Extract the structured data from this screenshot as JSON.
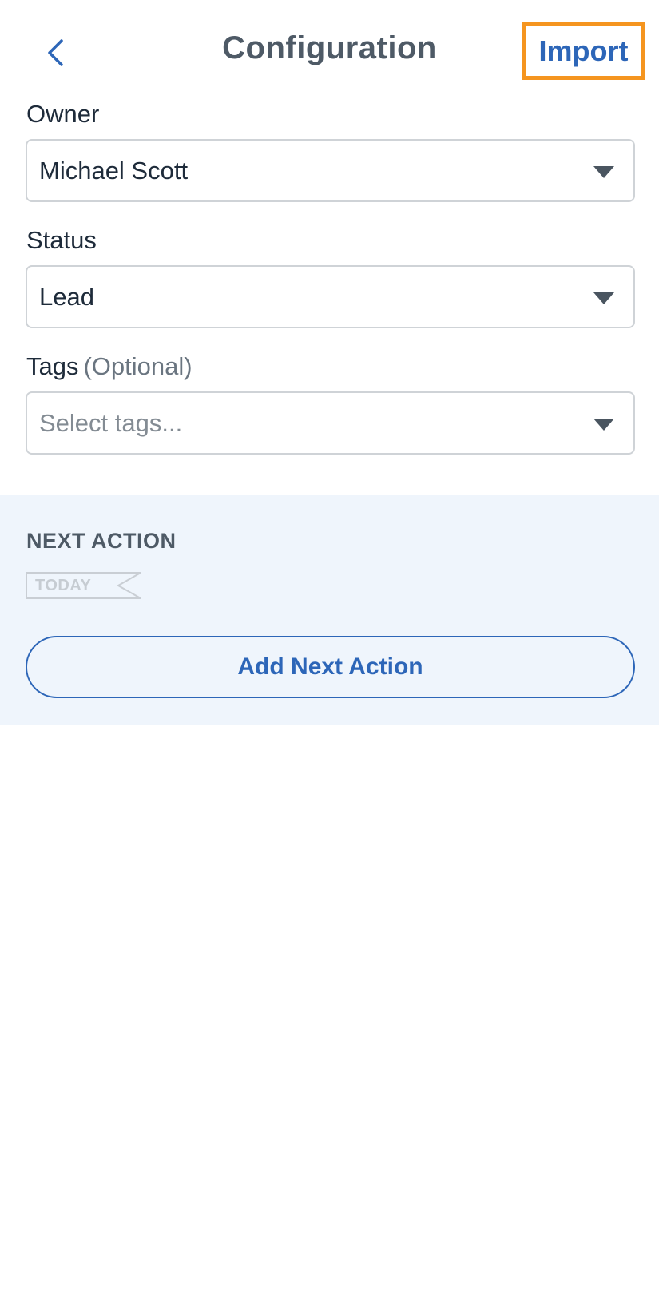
{
  "header": {
    "title": "Configuration",
    "import_label": "Import",
    "accent_color": "#2d66b8",
    "highlight_color": "#f5951f"
  },
  "form": {
    "owner": {
      "label": "Owner",
      "value": "Michael Scott"
    },
    "status": {
      "label": "Status",
      "value": "Lead"
    },
    "tags": {
      "label": "Tags",
      "optional_label": "(Optional)",
      "placeholder": "Select tags..."
    }
  },
  "next_action": {
    "heading": "NEXT ACTION",
    "tag_label": "TODAY",
    "add_button_label": "Add Next Action"
  },
  "colors": {
    "section_background": "#eff5fc",
    "text_primary": "#1e2b3a",
    "text_heading": "#4e5a66"
  }
}
